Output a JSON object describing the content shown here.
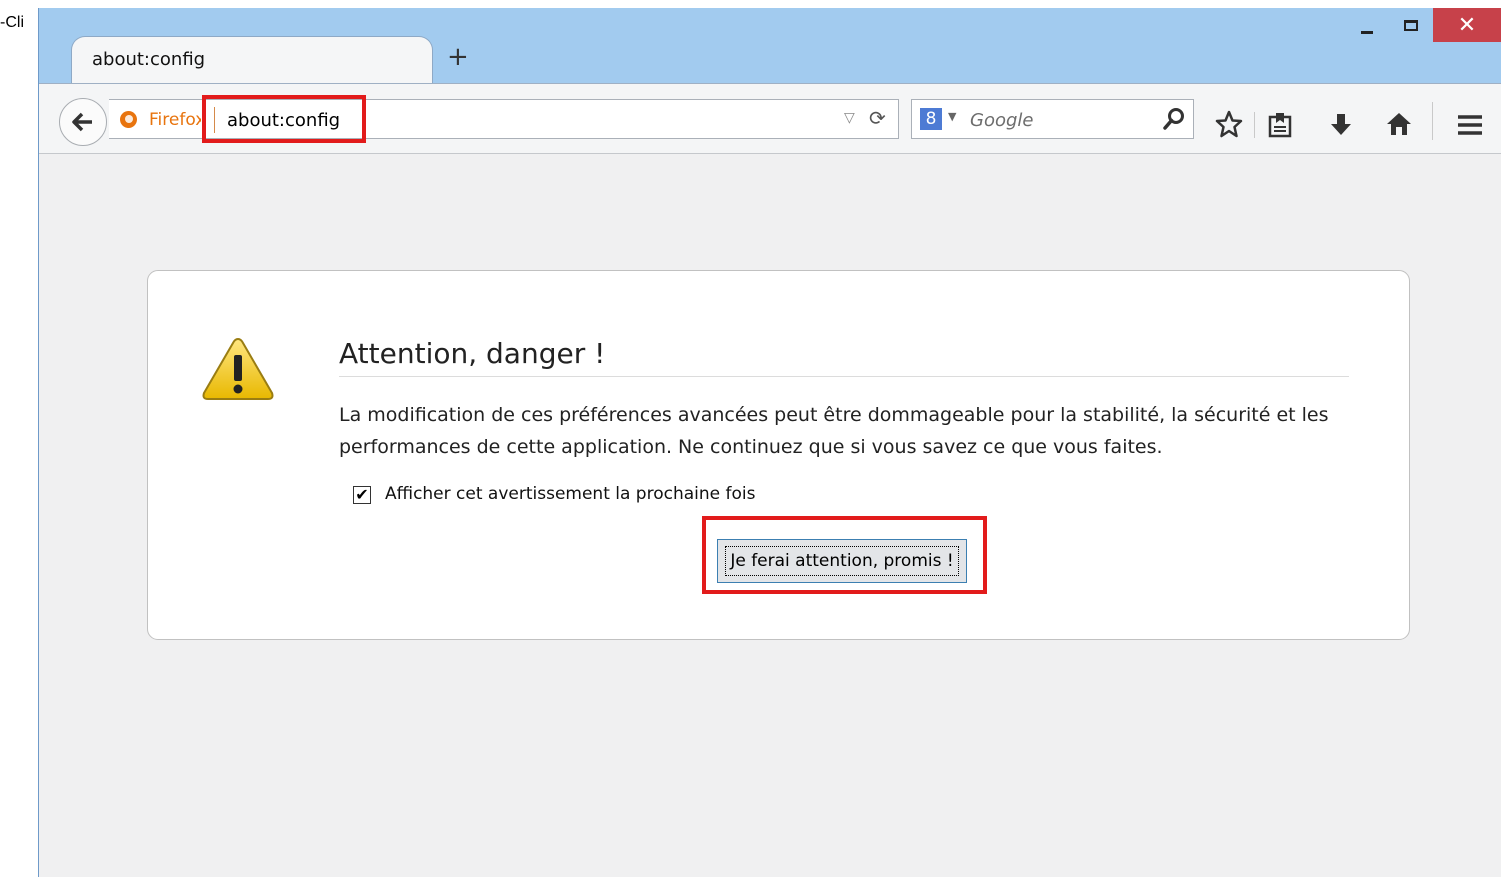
{
  "annotation": {
    "side_text": "-Cli"
  },
  "tab": {
    "title": "about:config",
    "new_tab_label": "+"
  },
  "window_controls": {
    "close_label": "✕"
  },
  "toolbar": {
    "identity_label": "Firefox",
    "url": "about:config",
    "search_engine_letter": "8",
    "search_placeholder": "Google"
  },
  "warning": {
    "title": "Attention, danger !",
    "message": "La modification de ces préférences avancées peut être dommageable pour la stabilité, la sécurité et les performances de cette application. Ne continuez que si vous savez ce que vous faites.",
    "checkbox_checked": true,
    "checkbox_label": "Afficher cet avertissement la prochaine fois",
    "button_label": "Je ferai attention, promis !"
  },
  "colors": {
    "titlebar": "#a2cbef",
    "close_button": "#c7414a",
    "highlight": "#e21b1b",
    "firefox_orange": "#e8740e"
  }
}
